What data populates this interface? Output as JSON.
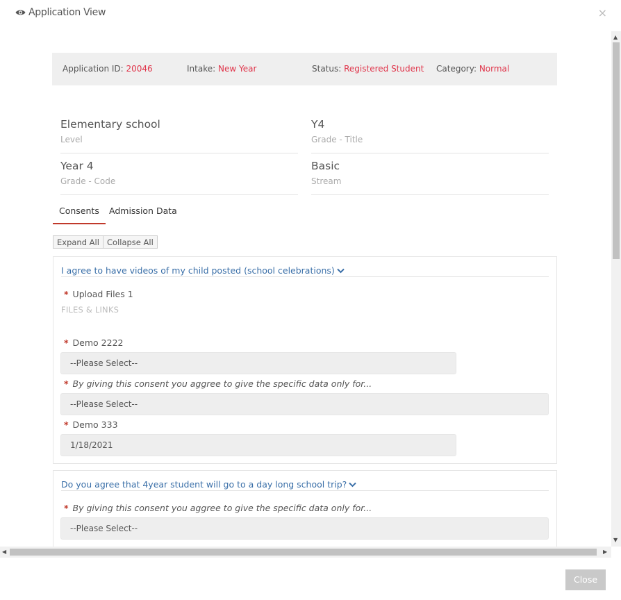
{
  "modal": {
    "title": "Application View",
    "close_glyph": "×"
  },
  "info": {
    "application_id_label": "Application ID:",
    "application_id_value": "20046",
    "intake_label": "Intake:",
    "intake_value": "New Year",
    "status_label": "Status:",
    "status_value": "Registered Student",
    "category_label": "Category:",
    "category_value": "Normal"
  },
  "fields": [
    {
      "value": "Elementary school",
      "label": "Level"
    },
    {
      "value": "Y4",
      "label": "Grade - Title"
    },
    {
      "value": "Year 4",
      "label": "Grade - Code"
    },
    {
      "value": "Basic",
      "label": "Stream"
    }
  ],
  "tabs": [
    {
      "label": "Consents",
      "active": true
    },
    {
      "label": "Admission Data",
      "active": false
    }
  ],
  "buttons": {
    "expand_all": "Expand All",
    "collapse_all": "Collapse All",
    "close": "Close"
  },
  "panels": [
    {
      "title": "I agree to have videos of my child posted (school celebrations)",
      "q1_label": "Upload Files 1",
      "q1_sub": "FILES & LINKS",
      "q2_label": "Demo 2222",
      "q2_value": "--Please Select--",
      "q3_label": "By giving this consent you aggree to give the specific data only for...",
      "q3_value": "--Please Select--",
      "q4_label": "Demo 333",
      "q4_value": "1/18/2021"
    },
    {
      "title": "Do you agree that 4year student will go to a day long school trip?",
      "q1_label": "By giving this consent you aggree to give the specific data only for...",
      "q1_value": "--Please Select--"
    }
  ],
  "icons": {
    "title_icon": "eye-icon",
    "expand_icon": "chevron-down-icon",
    "close_icon": "close-icon"
  },
  "colors": {
    "accent_red": "#e0344a",
    "link_blue": "#3a6fa8",
    "tab_underline": "#c0392b"
  }
}
